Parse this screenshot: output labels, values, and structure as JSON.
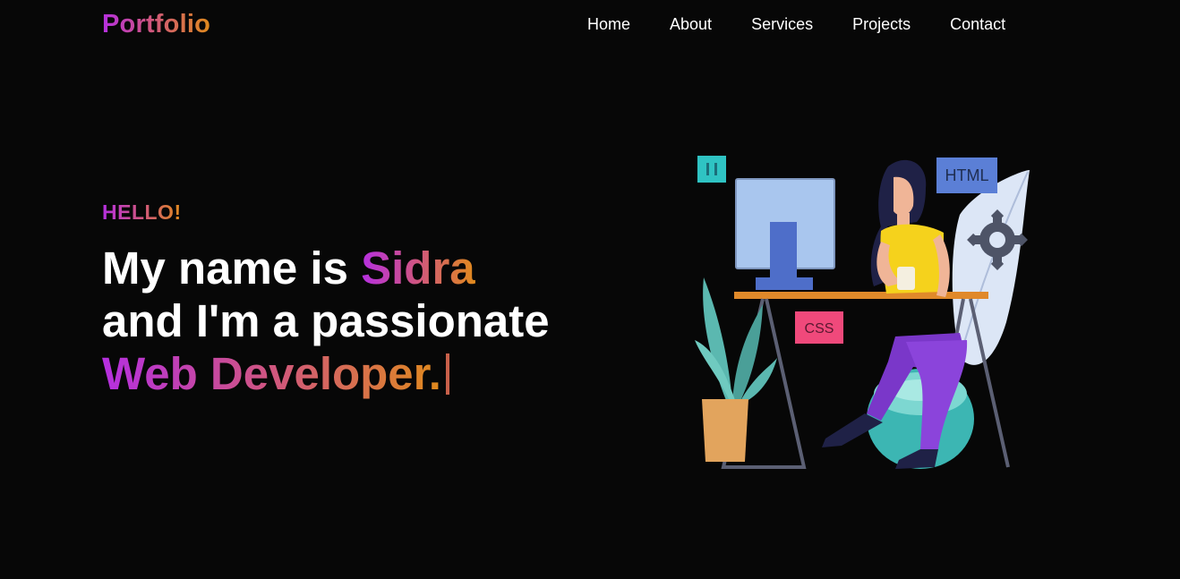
{
  "nav": {
    "logo": "Portfolio",
    "links": [
      "Home",
      "About",
      "Services",
      "Projects",
      "Contact"
    ]
  },
  "hero": {
    "greeting": "HELLO!",
    "line1_prefix": "My name is ",
    "name": "Sidra",
    "line2": "and I'm a passionate",
    "role": "Web Developer."
  },
  "illustration": {
    "html_tag": "HTML",
    "css_tag": "CSS",
    "code_icon": "code-icon",
    "gear_icon": "gear-icon"
  },
  "colors": {
    "background": "#070707",
    "gradient_start": "#b52fe0",
    "gradient_mid": "#d0567f",
    "gradient_end": "#e08a1c",
    "text": "#ffffff"
  }
}
